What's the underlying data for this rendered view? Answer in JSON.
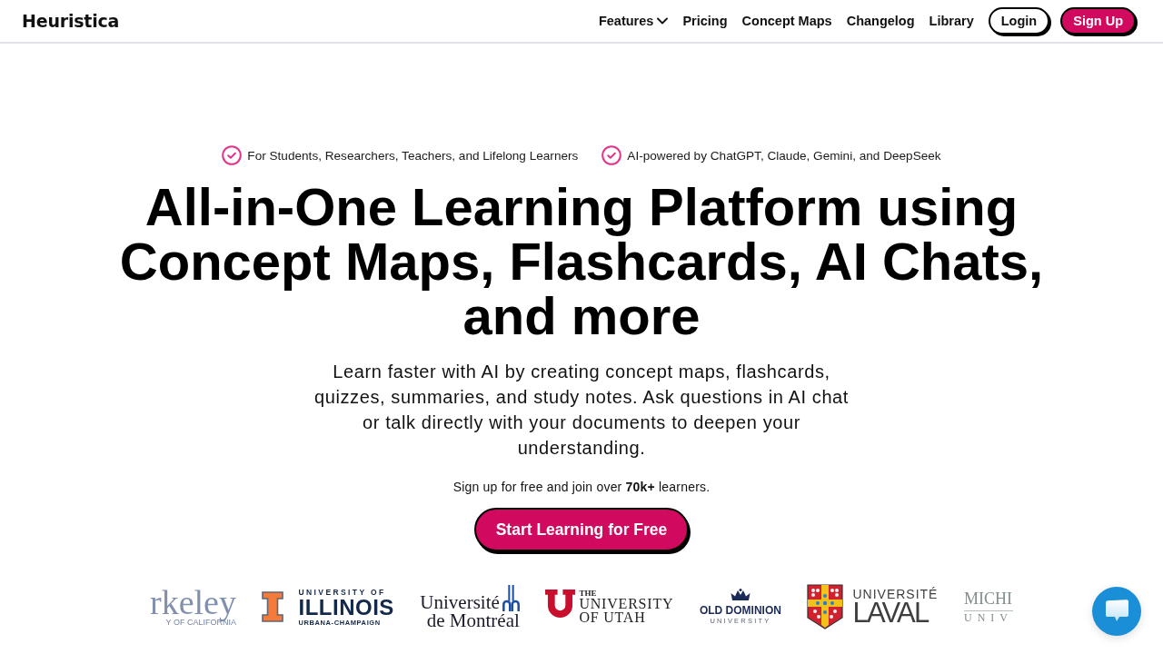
{
  "nav": {
    "brand": "Heuristica",
    "links": [
      {
        "label": "Features",
        "kind": "dropdown"
      },
      {
        "label": "Pricing",
        "kind": "link"
      },
      {
        "label": "Concept Maps",
        "kind": "link"
      },
      {
        "label": "Changelog",
        "kind": "link"
      },
      {
        "label": "Library",
        "kind": "link"
      }
    ],
    "buttons": [
      {
        "label": "Login",
        "kind": "outline"
      },
      {
        "label": "Sign Up",
        "kind": "filled"
      }
    ]
  },
  "hero": {
    "badges": [
      "For Students, Researchers, Teachers, and Lifelong Learners",
      "AI-powered by ChatGPT, Claude, Gemini, and DeepSeek"
    ],
    "title": "All-in-One Learning Platform using Concept Maps, Flashcards, AI Chats, and more",
    "description": "Learn faster with AI by creating concept maps, flashcards, quizzes, summaries, and study notes. Ask questions in AI chat or talk directly with your documents to deepen your understanding.",
    "signup_note": "Sign up for free and join over **70k+** learners.",
    "cta": "Start Learning for Free"
  },
  "logos": [
    {
      "kind": "wordmark",
      "lines": [
        "rkeley",
        "Y OF CALIFORNIA"
      ]
    },
    {
      "kind": "block-i",
      "lines": [
        "UNIVERSITY OF",
        "ILLINOIS",
        "URBANA-CHAMPAIGN"
      ]
    },
    {
      "kind": "arches",
      "lines": [
        "Université",
        "de Montréal"
      ]
    },
    {
      "kind": "block-u",
      "lines": [
        "THE",
        "UNIVERSITY",
        "OF UTAH"
      ]
    },
    {
      "kind": "crown",
      "lines": [
        "OLD DOMINION",
        "UNIVERSITY"
      ]
    },
    {
      "kind": "shield",
      "lines": [
        "UNIVERSITÉ",
        "LAVAL"
      ]
    },
    {
      "kind": "wordmark-light",
      "lines": [
        "MICHI",
        "UNIV"
      ]
    }
  ]
}
